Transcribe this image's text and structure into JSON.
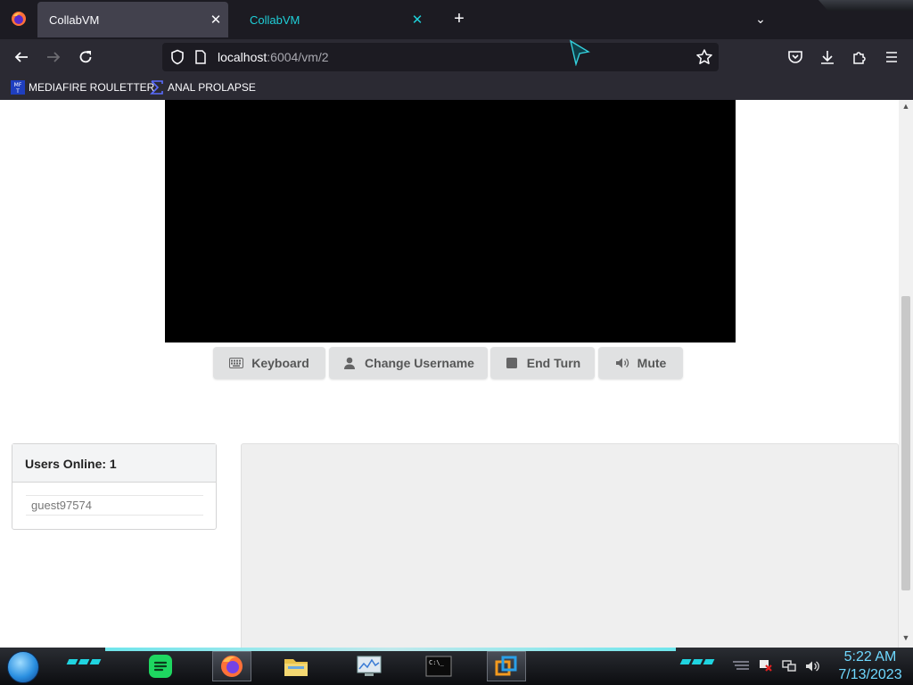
{
  "browser": {
    "tabs": [
      {
        "title": "CollabVM",
        "close": "✕"
      },
      {
        "title": "CollabVM",
        "close": "✕"
      }
    ],
    "new_tab_glyph": "+",
    "list_tabs_glyph": "⌄",
    "url": {
      "host": "localhost",
      "rest": ":6004/vm/2"
    },
    "bookmarks": [
      {
        "label": "MEDIAFIRE ROULETTER",
        "icon": "mediafire-icon"
      },
      {
        "label": "ANAL PROLAPSE",
        "icon": "sigma-icon"
      }
    ],
    "accent_color": "#1fcfd8"
  },
  "vm": {
    "buttons": [
      {
        "label": "Keyboard",
        "icon": "keyboard-icon"
      },
      {
        "label": "Change Username",
        "icon": "user-icon"
      },
      {
        "label": "End Turn",
        "icon": "stop-icon"
      },
      {
        "label": "Mute",
        "icon": "volume-icon"
      }
    ]
  },
  "users": {
    "header": "Users Online: 1",
    "list": [
      "guest97574"
    ]
  },
  "taskbar": {
    "apps": [
      "spotify-icon",
      "firefox-icon",
      "file-manager-icon",
      "system-monitor-icon",
      "terminal-icon",
      "vmware-icon"
    ],
    "terminal_text": "C:\\_",
    "clock": {
      "time": "5:22 AM",
      "date": "7/13/2023"
    },
    "accent_color": "#20d4e0"
  }
}
